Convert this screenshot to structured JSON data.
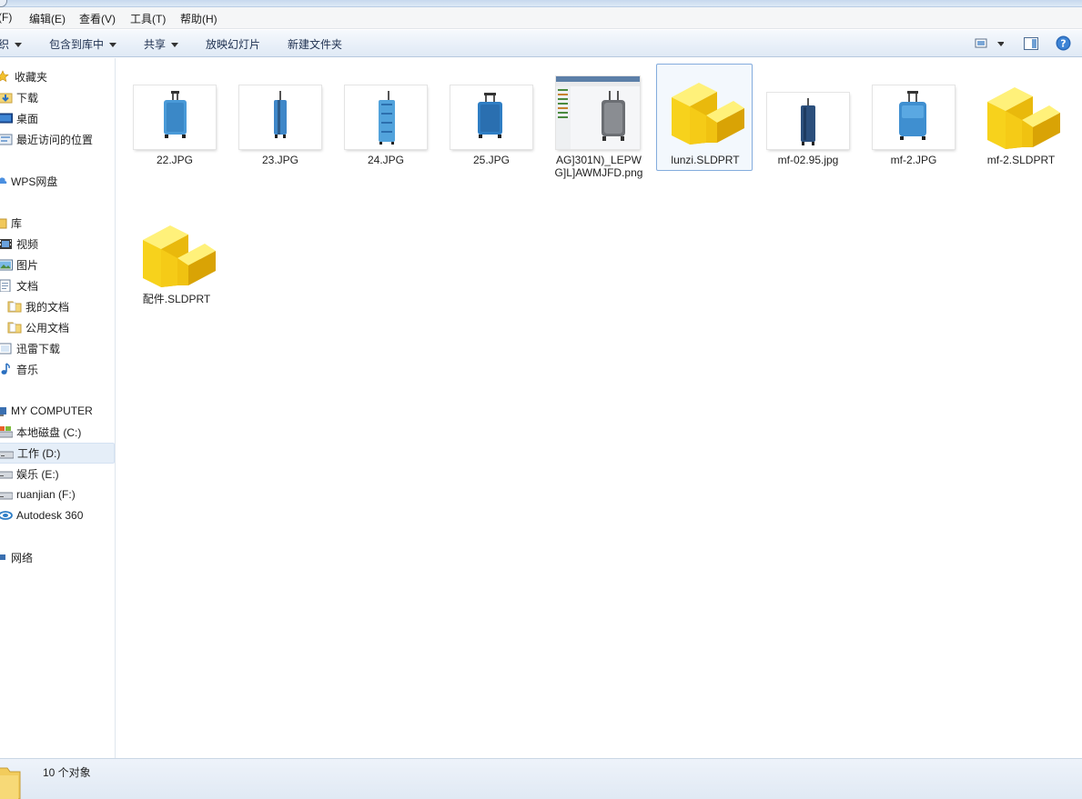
{
  "menu": [
    {
      "label": "(F)"
    },
    {
      "label": "编辑(E)"
    },
    {
      "label": "查看(V)"
    },
    {
      "label": "工具(T)"
    },
    {
      "label": "帮助(H)"
    }
  ],
  "toolbar": {
    "organize": "织",
    "include_library": "包含到库中",
    "share": "共享",
    "slideshow": "放映幻灯片",
    "new_folder": "新建文件夹"
  },
  "nav": {
    "favorites": "收藏夹",
    "downloads": "下载",
    "desktop": "桌面",
    "recent": "最近访问的位置",
    "wps": "WPS网盘",
    "library": "库",
    "video": "视频",
    "pictures": "图片",
    "documents": "文档",
    "my_docs": "我的文档",
    "public_docs": "公用文档",
    "xunlei": "迅雷下载",
    "music": "音乐",
    "computer": "MY COMPUTER",
    "drive_c": "本地磁盘 (C:)",
    "drive_d": "工作 (D:)",
    "drive_e": "娱乐 (E:)",
    "drive_f": "ruanjian (F:)",
    "autodesk": "Autodesk 360",
    "network": "网络"
  },
  "files": [
    {
      "name": "22.JPG",
      "kind": "suitcase-image"
    },
    {
      "name": "23.JPG",
      "kind": "suitcase-image"
    },
    {
      "name": "24.JPG",
      "kind": "suitcase-image"
    },
    {
      "name": "25.JPG",
      "kind": "suitcase-image"
    },
    {
      "name": "AG]301N)_LEPWG]L]AWMJFD.png",
      "kind": "cad-screenshot"
    },
    {
      "name": "lunzi.SLDPRT",
      "kind": "sldprt-part"
    },
    {
      "name": "mf-02.95.jpg",
      "kind": "suitcase-image"
    },
    {
      "name": "mf-2.JPG",
      "kind": "suitcase-image"
    },
    {
      "name": "mf-2.SLDPRT",
      "kind": "sldprt-part"
    },
    {
      "name": "配件.SLDPRT",
      "kind": "sldprt-part"
    }
  ],
  "status": {
    "count": "10 个对象"
  },
  "colors": {
    "suitcase_blue": "#3f8fce",
    "suitcase_dark": "#2c5b8a",
    "part_yellow": "#f7d21c",
    "selection": "#84acdd"
  }
}
